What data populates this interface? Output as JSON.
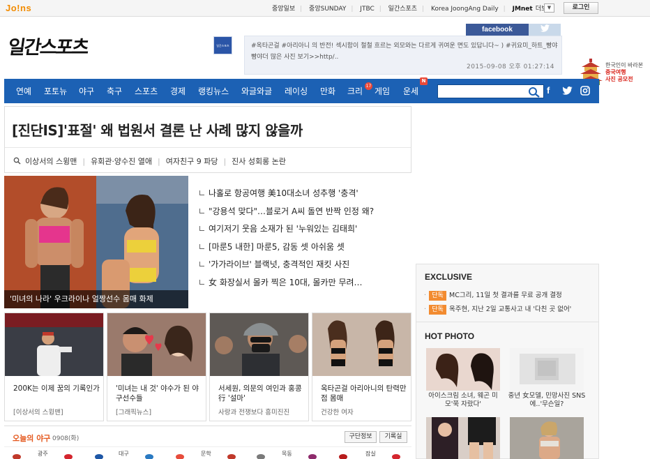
{
  "topbar": {
    "logo": "Jo!ns",
    "links": [
      "중앙일보",
      "중앙SUNDAY",
      "JTBC",
      "일간스포츠",
      "Korea JoongAng Daily"
    ],
    "jmnet": "JMnet",
    "more": "더보기",
    "more_btn": "▼",
    "login": "로그인"
  },
  "header": {
    "logo": "일간스포츠",
    "facebook_thumb": "일간스포츠",
    "facebook_tab": "facebook",
    "twitter_tab": "twitter",
    "facebook_text": "#옥타곤걸 #아리아니 의 반전! 섹시함이 철철 흐르는 외모와는 다르게 귀여운 면도 있답니다~ ) #귀요미_하트_빵야빵야더 많은 사진 보기>>http/..",
    "facebook_date": "2015-09-08 오후 01:27:14",
    "promo_line1": "한국인이 바라본",
    "promo_line2": "중국여행",
    "promo_line3": "사진 공모전"
  },
  "nav": {
    "items": [
      "연예",
      "포토뉴",
      "야구",
      "축구",
      "스포츠",
      "경제",
      "랭킹뉴스",
      "와글와글",
      "레이싱",
      "만화",
      "크리",
      "게임",
      "운세"
    ],
    "kri_badge": "17",
    "new_badge": "N",
    "search_placeholder": "",
    "social": [
      "f",
      "t",
      "in"
    ]
  },
  "headline": {
    "title": "[진단IS]'표절' 왜 법원서 결론 난 사례 많지 않을까",
    "keywords": [
      "이상서의 스윙맨",
      "유회관·양수진 열애",
      "여자친구 9 파당",
      "진사 성회롱 논란"
    ]
  },
  "feature": {
    "caption": "'미녀의 나라' 우크라이나 얼짱선수 몸매 화제",
    "news": [
      "나홀로 항공여행 美10대소녀 성추행 '충격'",
      "\"강용석 맞다\"…블로거 A씨 돌연 반짝 인정 왜?",
      "여기저기 웃음 소재가 된 '누워있는 김태희'",
      "[마룬5 내한] 마룬5, 감동 셋 아쉬움 셋",
      "'가가라이브' 블랙넛, 충격적인 재킷 사진",
      "女 화장실서 몰카 찍은 10대, 몰카만 무려…"
    ]
  },
  "cards": [
    {
      "title": "200K는 이제 꿈의 기록인가",
      "src": "[이상서의 스윙맨]"
    },
    {
      "title": "'미녀는 내 것' 야수가 된 야구선수들",
      "src": "[그래픽뉴스]"
    },
    {
      "title": "서세원, 의문의 여인과 홍콩行 '설마'",
      "src": "사랑과 전쟁보다 흥미진진"
    },
    {
      "title": "옥타곤걸 아리아니의 탄력만점 몸매",
      "src": "건강한 여자"
    }
  ],
  "baseball": {
    "title": "오늘의 야구",
    "date": "0908(화)",
    "btn1": "구단정보",
    "btn2": "기록실",
    "venues": [
      "광주",
      "대구",
      "문학",
      "목동",
      "잠실"
    ]
  },
  "exclusive": {
    "title": "EXCLUSIVE",
    "items": [
      {
        "tag": "단독",
        "text": "MC그리, 11일 첫 결과를 무료 공개 결정"
      },
      {
        "tag": "단독",
        "text": "옥주현, 지난 2일 교통사고 내 '다친 곳 없어'"
      }
    ]
  },
  "hot_photo": {
    "title": "HOT PHOTO",
    "items": [
      {
        "caption": "아이스크림 소녀, 웨곤 미모'쭉 자랐다'"
      },
      {
        "caption": "중년 女모델, 민망사진 SNS에..'무슨일?"
      }
    ]
  }
}
